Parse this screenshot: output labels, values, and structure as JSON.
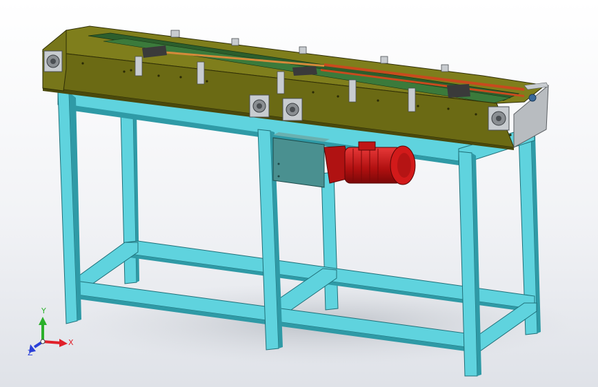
{
  "viewport": {
    "background_top": "#ffffff",
    "background_bottom": "#dfe2e8"
  },
  "model": {
    "frame_color": "#5fd3de",
    "frame_dark": "#2f9aa6",
    "frame_light": "#9ff0f6",
    "conveyor_body_color": "#6b6a14",
    "conveyor_top_color": "#7f7e1c",
    "belt_color": "#2c5e2c",
    "rail_color": "#c84a1e",
    "motor_color": "#c81414",
    "gearbox_color": "#4a9090",
    "plate_color": "#b8bcc0",
    "bracket_color": "#c8ccd0"
  },
  "triad": {
    "x_label": "X",
    "y_label": "Y",
    "z_label": "Z",
    "x_color": "#e0202a",
    "y_color": "#2bb02b",
    "z_color": "#2a3fd8"
  }
}
